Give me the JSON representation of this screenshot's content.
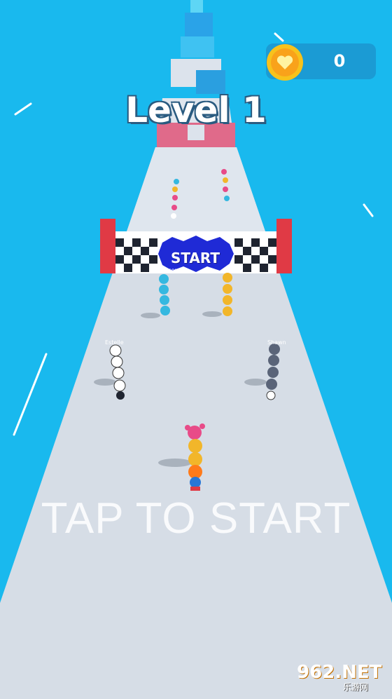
{
  "hud": {
    "coin_count": "0",
    "coin_icon": "heart-coin-icon",
    "level_title": "Level 1"
  },
  "track": {
    "start_banner": "START",
    "name_tags": [
      "Spencer",
      "Estelle",
      "Shawn"
    ]
  },
  "prompt": {
    "tap_to_start": "TAP TO START"
  },
  "watermark": {
    "main": "962.NET",
    "sub": "乐游网"
  },
  "colors": {
    "water": "#19b9ee",
    "track": "#d6dde6",
    "coin": "#f7c21c",
    "start_post": "#e03a45"
  }
}
